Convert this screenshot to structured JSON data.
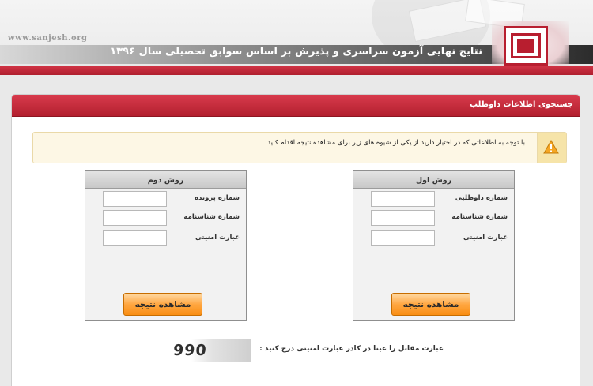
{
  "header": {
    "site_url": "www.sanjesh.org",
    "title": "نتایج نهایی آزمون سراسری و پذیرش بر اساس سوابق تحصیلی سال ۱۳۹۶",
    "logo": "sanjesh-logo"
  },
  "panel": {
    "title": "جستجوی اطلاعات داوطلب",
    "notice_text": "با توجه به اطلاعاتی که در اختیار دارید از یکی از شیوه های زیر برای مشاهده نتیجه اقدام کنید",
    "notice_icon": "warning-icon"
  },
  "method1": {
    "title": "روش اول",
    "fields": [
      {
        "label": "شماره داوطلبی",
        "value": ""
      },
      {
        "label": "شماره شناسنامه",
        "value": ""
      },
      {
        "label": "عبارت امنیتی",
        "value": ""
      }
    ],
    "button": "مشاهده نتیجه"
  },
  "method2": {
    "title": "روش دوم",
    "fields": [
      {
        "label": "شماره پرونده",
        "value": ""
      },
      {
        "label": "شماره شناسنامه",
        "value": ""
      },
      {
        "label": "عبارت امنیتی",
        "value": ""
      }
    ],
    "button": "مشاهده نتیجه"
  },
  "captcha": {
    "label": "عبارت مقابل را عینا در کادر عبارت امنیتی درج کنید :",
    "code": "990"
  },
  "colors": {
    "brand_red": "#b81e2f",
    "button_orange": "#ffa742",
    "notice_bg": "#fdf7e5"
  }
}
